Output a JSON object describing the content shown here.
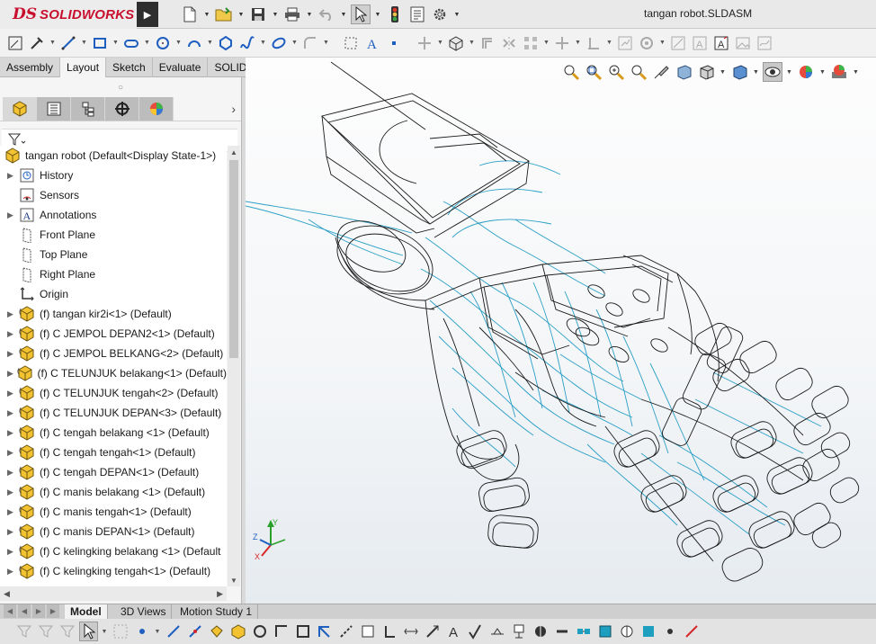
{
  "app": {
    "logo_mark": "DS",
    "logo_text": "SOLIDWORKS",
    "document_title": "tangan robot.SLDASM"
  },
  "title_toolbar": [
    "new-document-icon",
    "open-folder-icon",
    "save-icon",
    "print-icon",
    "undo-icon",
    "select-arrow-icon",
    "rebuild-traffic-light-icon",
    "file-properties-icon",
    "options-gear-icon"
  ],
  "command_tabs": [
    {
      "label": "Assembly",
      "active": false
    },
    {
      "label": "Layout",
      "active": true
    },
    {
      "label": "Sketch",
      "active": false
    },
    {
      "label": "Evaluate",
      "active": false
    },
    {
      "label": "SOLIDWORKS Add-Ins",
      "active": false
    }
  ],
  "feature_tree": {
    "root": "tangan robot  (Default<Display State-1>)",
    "items": [
      {
        "label": "History",
        "icon": "history-icon",
        "expandable": true
      },
      {
        "label": "Sensors",
        "icon": "sensors-icon",
        "expandable": false
      },
      {
        "label": "Annotations",
        "icon": "annotations-icon",
        "expandable": true
      },
      {
        "label": "Front Plane",
        "icon": "plane-icon",
        "expandable": false
      },
      {
        "label": "Top Plane",
        "icon": "plane-icon",
        "expandable": false
      },
      {
        "label": "Right Plane",
        "icon": "plane-icon",
        "expandable": false
      },
      {
        "label": "Origin",
        "icon": "origin-icon",
        "expandable": false
      },
      {
        "label": "(f) tangan kir2i<1> (Default)",
        "icon": "part-icon",
        "expandable": true
      },
      {
        "label": "(f) C JEMPOL DEPAN2<1> (Default)",
        "icon": "part-icon",
        "expandable": true
      },
      {
        "label": "(f) C JEMPOL BELKANG<2> (Default)",
        "icon": "part-icon",
        "expandable": true
      },
      {
        "label": "(f) C TELUNJUK belakang<1> (Default)",
        "icon": "part-icon",
        "expandable": true
      },
      {
        "label": "(f) C TELUNJUK tengah<2> (Default)",
        "icon": "part-icon",
        "expandable": true
      },
      {
        "label": "(f) C TELUNJUK DEPAN<3> (Default)",
        "icon": "part-icon",
        "expandable": true
      },
      {
        "label": "(f) C tengah belakang <1> (Default)",
        "icon": "part-icon",
        "expandable": true
      },
      {
        "label": "(f) C tengah tengah<1> (Default)",
        "icon": "part-icon",
        "expandable": true
      },
      {
        "label": "(f) C tengah DEPAN<1> (Default)",
        "icon": "part-icon",
        "expandable": true
      },
      {
        "label": "(f) C manis belakang <1> (Default)",
        "icon": "part-icon",
        "expandable": true
      },
      {
        "label": "(f) C manis tengah<1> (Default)",
        "icon": "part-icon",
        "expandable": true
      },
      {
        "label": "(f) C manis DEPAN<1> (Default)",
        "icon": "part-icon",
        "expandable": true
      },
      {
        "label": "(f) C kelingking belakang <1> (Default",
        "icon": "part-icon",
        "expandable": true
      },
      {
        "label": "(f) C kelingking tengah<1> (Default)",
        "icon": "part-icon",
        "expandable": true
      }
    ]
  },
  "manager_tabs": [
    "feature-manager-tab-icon",
    "property-manager-tab-icon",
    "configuration-manager-tab-icon",
    "dimxpert-manager-tab-icon",
    "display-manager-tab-icon"
  ],
  "bottom_tabs": [
    {
      "label": "Model",
      "active": true
    },
    {
      "label": "3D Views",
      "active": false
    },
    {
      "label": "Motion Study 1",
      "active": false
    }
  ],
  "triad": {
    "x": "X",
    "y": "Y",
    "z": "Z"
  },
  "colors": {
    "wire_black": "#1a1a1a",
    "wire_blue": "#2a9fc6",
    "logo_red": "#c8102e",
    "panel_bg": "#f5f5f5"
  }
}
